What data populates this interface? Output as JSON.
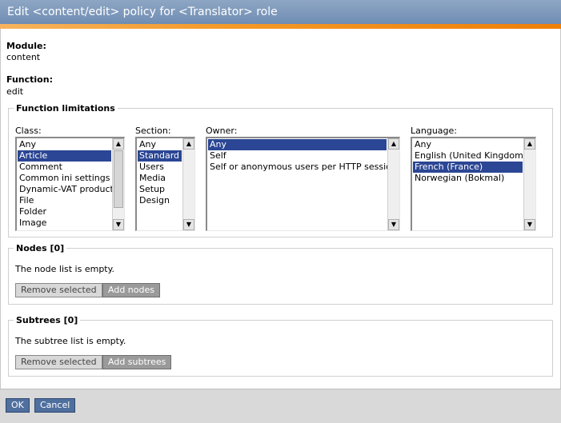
{
  "title": "Edit <content/edit> policy for <Translator> role",
  "module": {
    "label": "Module:",
    "value": "content"
  },
  "function": {
    "label": "Function:",
    "value": "edit"
  },
  "limitations": {
    "legend": "Function limitations",
    "class": {
      "label": "Class:",
      "options": [
        "Any",
        "Article",
        "Comment",
        "Common ini settings",
        "Dynamic-VAT product",
        "File",
        "Folder",
        "Image"
      ],
      "selected": "Article"
    },
    "section": {
      "label": "Section:",
      "options": [
        "Any",
        "Standard",
        "Users",
        "Media",
        "Setup",
        "Design"
      ],
      "selected": "Standard"
    },
    "owner": {
      "label": "Owner:",
      "options": [
        "Any",
        "Self",
        "Self or anonymous users per HTTP session"
      ],
      "selected": "Any"
    },
    "language": {
      "label": "Language:",
      "options": [
        "Any",
        "English (United Kingdom)",
        "French (France)",
        "Norwegian (Bokmal)"
      ],
      "selected": "French (France)"
    }
  },
  "nodes": {
    "legend": "Nodes [0]",
    "empty_text": "The node list is empty.",
    "remove_label": "Remove selected",
    "add_label": "Add nodes"
  },
  "subtrees": {
    "legend": "Subtrees [0]",
    "empty_text": "The subtree list is empty.",
    "remove_label": "Remove selected",
    "add_label": "Add subtrees"
  },
  "footer": {
    "ok_label": "OK",
    "cancel_label": "Cancel"
  }
}
